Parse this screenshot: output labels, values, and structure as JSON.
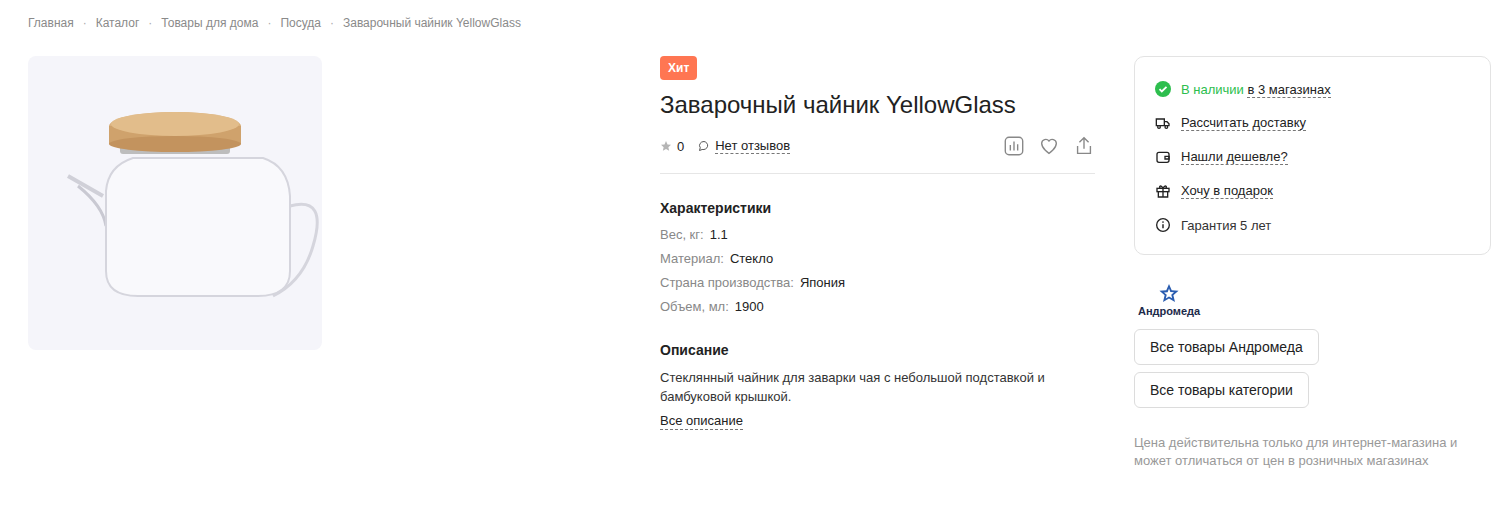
{
  "breadcrumbs": {
    "separator": "·",
    "items": [
      "Главная",
      "Каталог",
      "Товары для дома",
      "Посуда",
      "Заварочный чайник YellowGlass"
    ]
  },
  "badge": "Хит",
  "title": "Заварочный чайник YellowGlass",
  "rating": {
    "stars": 0,
    "value": "0",
    "reviews": "Нет отзывов"
  },
  "specs": {
    "title": "Характеристики",
    "rows": [
      {
        "label": "Вес, кг:",
        "value": "1.1"
      },
      {
        "label": "Материал:",
        "value": "Стекло"
      },
      {
        "label": "Страна производства:",
        "value": "Япония"
      },
      {
        "label": "Объем, мл:",
        "value": "1900"
      }
    ]
  },
  "description": {
    "title": "Описание",
    "text": "Стеклянный чайник для заварки чая с небольшой подставкой и бамбуковой крышкой.",
    "more": "Все описание"
  },
  "availability": {
    "status": "В наличии",
    "stores": "в 3 магазинах"
  },
  "actions": [
    {
      "label": "Рассчитать доставку",
      "kind": "link"
    },
    {
      "label": "Нашли дешевле?",
      "kind": "link"
    },
    {
      "label": "Хочу в подарок",
      "kind": "link"
    },
    {
      "label": "Гарантия 5 лет",
      "kind": "info"
    }
  ],
  "brand": {
    "name": "Андромеда"
  },
  "buttons": [
    "Все товары Андромеда",
    "Все товары категории"
  ],
  "note": "Цена действительна только для интернет-магазина и может отличаться от цен в розничных магазинах"
}
